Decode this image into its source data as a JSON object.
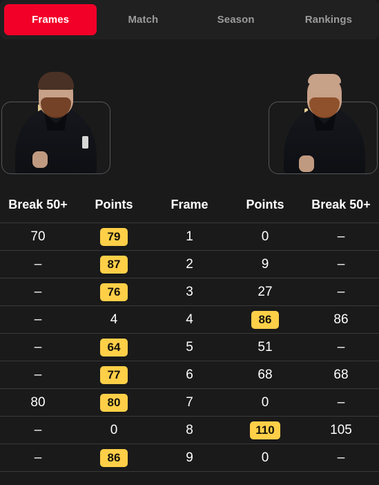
{
  "tabs": [
    {
      "label": "Frames",
      "active": true
    },
    {
      "label": "Match",
      "active": false
    },
    {
      "label": "Season",
      "active": false
    },
    {
      "label": "Rankings",
      "active": false
    }
  ],
  "players": {
    "left": {
      "name": "player-left-photo"
    },
    "right": {
      "name": "player-right-photo"
    }
  },
  "table": {
    "headers": [
      "Break 50+",
      "Points",
      "Frame",
      "Points",
      "Break 50+"
    ],
    "rows": [
      {
        "break_left": "70",
        "points_left": "79",
        "points_left_hl": true,
        "frame": "1",
        "points_right": "0",
        "points_right_hl": false,
        "break_right": "–"
      },
      {
        "break_left": "–",
        "points_left": "87",
        "points_left_hl": true,
        "frame": "2",
        "points_right": "9",
        "points_right_hl": false,
        "break_right": "–"
      },
      {
        "break_left": "–",
        "points_left": "76",
        "points_left_hl": true,
        "frame": "3",
        "points_right": "27",
        "points_right_hl": false,
        "break_right": "–"
      },
      {
        "break_left": "–",
        "points_left": "4",
        "points_left_hl": false,
        "frame": "4",
        "points_right": "86",
        "points_right_hl": true,
        "break_right": "86"
      },
      {
        "break_left": "–",
        "points_left": "64",
        "points_left_hl": true,
        "frame": "5",
        "points_right": "51",
        "points_right_hl": false,
        "break_right": "–"
      },
      {
        "break_left": "–",
        "points_left": "77",
        "points_left_hl": true,
        "frame": "6",
        "points_right": "68",
        "points_right_hl": false,
        "break_right": "68"
      },
      {
        "break_left": "80",
        "points_left": "80",
        "points_left_hl": true,
        "frame": "7",
        "points_right": "0",
        "points_right_hl": false,
        "break_right": "–"
      },
      {
        "break_left": "–",
        "points_left": "0",
        "points_left_hl": false,
        "frame": "8",
        "points_right": "110",
        "points_right_hl": true,
        "break_right": "105"
      },
      {
        "break_left": "–",
        "points_left": "86",
        "points_left_hl": true,
        "frame": "9",
        "points_right": "0",
        "points_right_hl": false,
        "break_right": "–"
      }
    ]
  },
  "colors": {
    "background": "#1a1a1a",
    "tabbar_background": "#202020",
    "active_tab": "#f20028",
    "badge": "#ffcf48",
    "divider": "#3a3a3a",
    "inactive_tab_text": "#9b9b9b"
  }
}
